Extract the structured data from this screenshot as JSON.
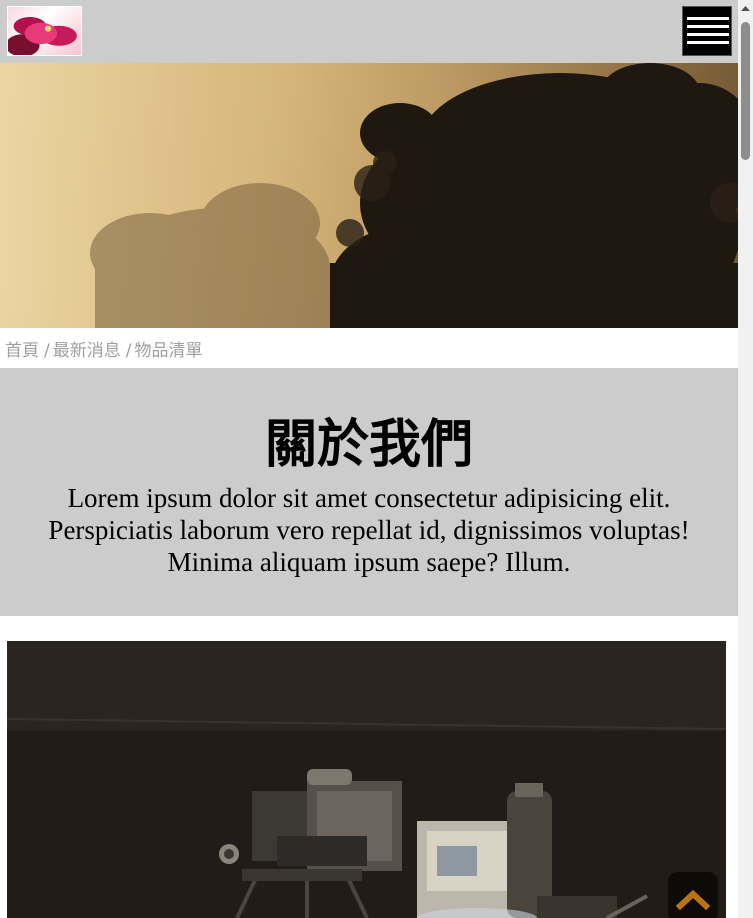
{
  "header": {
    "logo_alt": "logo",
    "menu_icon": "hamburger-icon"
  },
  "hero": {
    "image": "foggy-trees-sunrise"
  },
  "breadcrumb": {
    "items": [
      "首頁",
      "最新消息",
      "物品清單"
    ],
    "separator": "/"
  },
  "about": {
    "title": "關於我們",
    "text": "Lorem ipsum dolor sit amet consectetur adipisicing elit. Perspiciatis laborum vero repellat id, dignissimos voluptas! Minima aliquam ipsum saepe? Illum."
  },
  "photo": {
    "image": "vintage-cameras"
  },
  "back_to_top": {
    "icon": "chevron-up-icon",
    "color": "#b87316"
  },
  "colors": {
    "header_bg": "#cccccc",
    "about_bg": "#cccccc",
    "breadcrumb_text": "#a0a0a0"
  }
}
